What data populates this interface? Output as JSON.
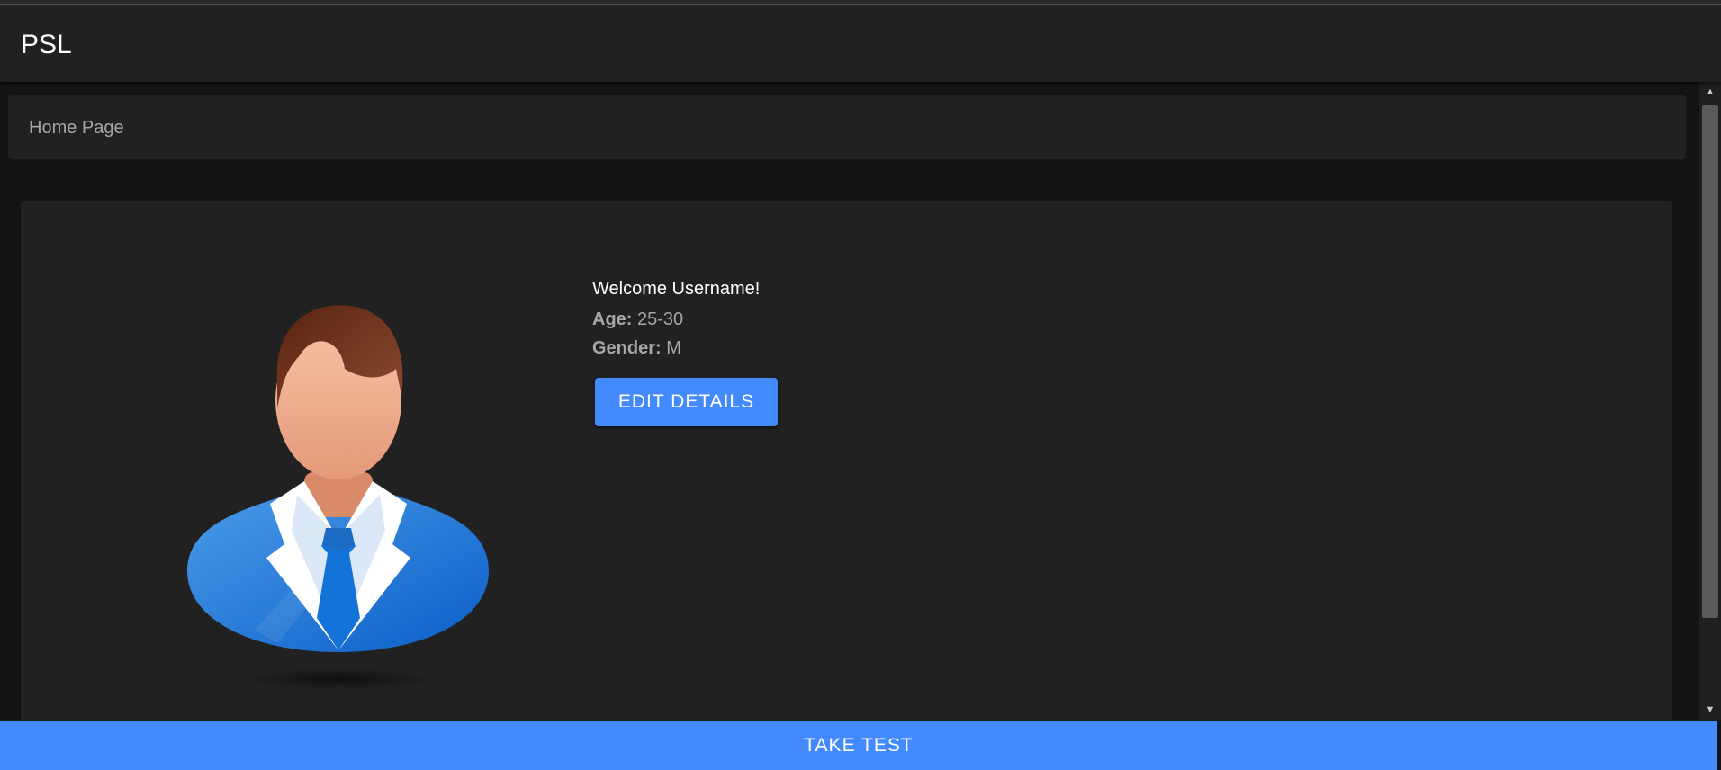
{
  "app": {
    "title": "PSL"
  },
  "breadcrumb": {
    "label": "Home Page"
  },
  "profile": {
    "welcome": "Welcome Username!",
    "age_label": "Age:",
    "age_value": "25-30",
    "gender_label": "Gender:",
    "gender_value": "M",
    "edit_button_label": "EDIT DETAILS",
    "avatar_icon": "user-avatar-icon"
  },
  "footer": {
    "take_test_label": "TAKE TEST"
  },
  "colors": {
    "accent": "#448aff",
    "background": "#141414",
    "surface": "#212121",
    "muted_text": "#a6a6a6"
  }
}
